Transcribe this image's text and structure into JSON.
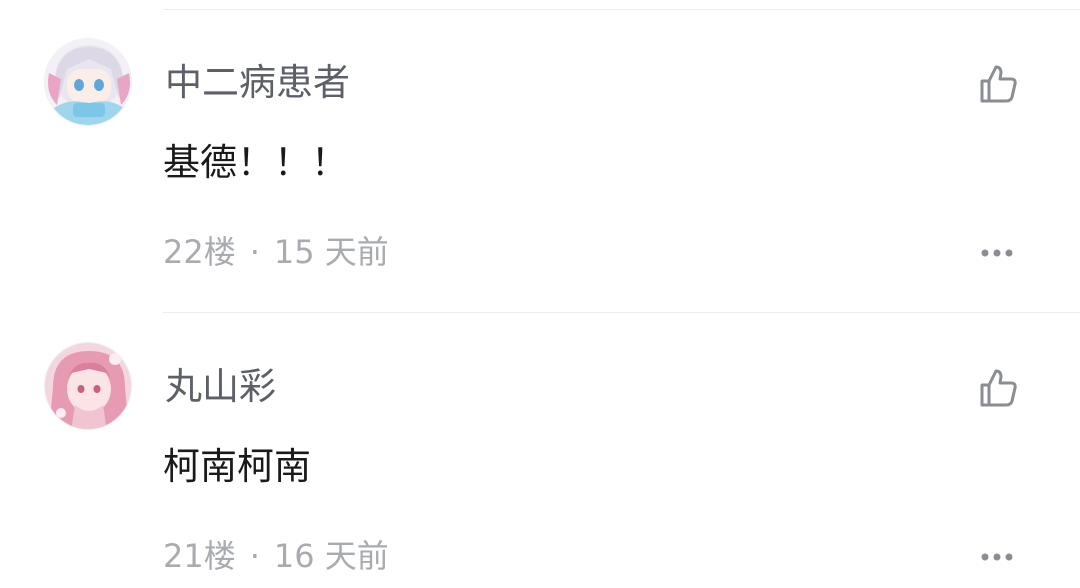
{
  "comments": [
    {
      "username": "中二病患者",
      "text": "基德！！！",
      "floor": "22楼",
      "separator": "·",
      "time": "15 天前",
      "avatar_icon": "anime-avatar-white-hair",
      "like_icon": "thumbs-up-icon",
      "more_icon": "more-dots-icon"
    },
    {
      "username": "丸山彩",
      "text": "柯南柯南",
      "floor": "21楼",
      "separator": "·",
      "time": "16 天前",
      "avatar_icon": "anime-avatar-pink-hair",
      "like_icon": "thumbs-up-icon",
      "more_icon": "more-dots-icon"
    }
  ],
  "colors": {
    "username": "#5d6068",
    "text": "#1a1a1a",
    "meta": "#a8abb0",
    "icon": "#8a8d93",
    "divider": "#ececec"
  }
}
